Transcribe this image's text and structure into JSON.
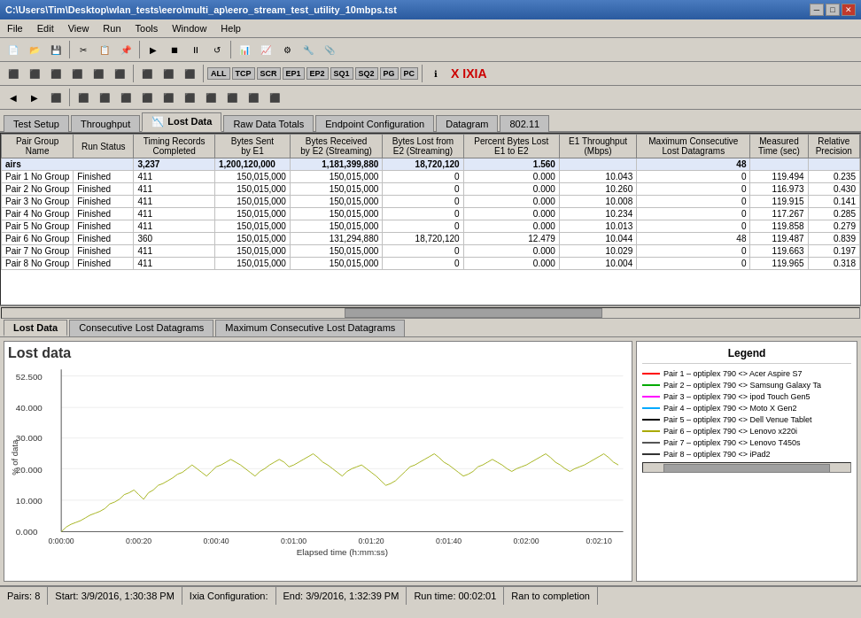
{
  "titleBar": {
    "text": "C:\\Users\\Tim\\Desktop\\wlan_tests\\eero\\multi_ap\\eero_stream_test_utility_10mbps.tst",
    "minimize": "─",
    "maximize": "□",
    "close": "✕"
  },
  "menuBar": {
    "items": [
      "File",
      "Edit",
      "View",
      "Run",
      "Tools",
      "Window",
      "Help"
    ]
  },
  "toolbar1": {
    "labels": [
      "TCP",
      "SCR",
      "EP1",
      "EP2",
      "SQ1",
      "SQ2",
      "PG",
      "PC"
    ]
  },
  "tabs": {
    "items": [
      "Test Setup",
      "Throughput",
      "Lost Data",
      "Raw Data Totals",
      "Endpoint Configuration",
      "Datagram",
      "802.11"
    ]
  },
  "tableHeaders": {
    "row1": [
      "Pair Group",
      "Run Status",
      "Timing Records",
      "Bytes Sent",
      "Bytes Received",
      "Bytes Lost from",
      "Percent Bytes Lost",
      "E1 Throughput",
      "Maximum Consecutive",
      "Measured",
      "Relative"
    ],
    "row2": [
      "Name",
      "",
      "Completed",
      "by E1",
      "by E2 (Streaming)",
      "E2 (Streaming)",
      "E1 to E2",
      "(Mbps)",
      "Lost Datagrams",
      "Time (sec)",
      "Precision"
    ]
  },
  "tableData": {
    "summaryRow": {
      "name": "airs",
      "records": "3,237",
      "bytesSent": "1,200,120,000",
      "bytesReceived": "1,181,399,880",
      "bytesLost": "18,720,120",
      "percentLost": "1.560",
      "throughput": "",
      "maxConsec": "48",
      "measuredTime": "",
      "precision": ""
    },
    "rows": [
      {
        "name": "Pair 1",
        "group": "No Group",
        "status": "Finished",
        "records": "411",
        "bytesSent": "150,015,000",
        "bytesReceived": "150,015,000",
        "bytesLost": "0",
        "percentLost": "0.000",
        "throughput": "10.043",
        "maxConsec": "0",
        "measuredTime": "119.494",
        "precision": "0.235"
      },
      {
        "name": "Pair 2",
        "group": "No Group",
        "status": "Finished",
        "records": "411",
        "bytesSent": "150,015,000",
        "bytesReceived": "150,015,000",
        "bytesLost": "0",
        "percentLost": "0.000",
        "throughput": "10.260",
        "maxConsec": "0",
        "measuredTime": "116.973",
        "precision": "0.430"
      },
      {
        "name": "Pair 3",
        "group": "No Group",
        "status": "Finished",
        "records": "411",
        "bytesSent": "150,015,000",
        "bytesReceived": "150,015,000",
        "bytesLost": "0",
        "percentLost": "0.000",
        "throughput": "10.008",
        "maxConsec": "0",
        "measuredTime": "119.915",
        "precision": "0.141"
      },
      {
        "name": "Pair 4",
        "group": "No Group",
        "status": "Finished",
        "records": "411",
        "bytesSent": "150,015,000",
        "bytesReceived": "150,015,000",
        "bytesLost": "0",
        "percentLost": "0.000",
        "throughput": "10.234",
        "maxConsec": "0",
        "measuredTime": "117.267",
        "precision": "0.285"
      },
      {
        "name": "Pair 5",
        "group": "No Group",
        "status": "Finished",
        "records": "411",
        "bytesSent": "150,015,000",
        "bytesReceived": "150,015,000",
        "bytesLost": "0",
        "percentLost": "0.000",
        "throughput": "10.013",
        "maxConsec": "0",
        "measuredTime": "119.858",
        "precision": "0.279"
      },
      {
        "name": "Pair 6",
        "group": "No Group",
        "status": "Finished",
        "records": "360",
        "bytesSent": "150,015,000",
        "bytesReceived": "131,294,880",
        "bytesLost": "18,720,120",
        "percentLost": "12.479",
        "throughput": "10.044",
        "maxConsec": "48",
        "measuredTime": "119.487",
        "precision": "0.839"
      },
      {
        "name": "Pair 7",
        "group": "No Group",
        "status": "Finished",
        "records": "411",
        "bytesSent": "150,015,000",
        "bytesReceived": "150,015,000",
        "bytesLost": "0",
        "percentLost": "0.000",
        "throughput": "10.029",
        "maxConsec": "0",
        "measuredTime": "119.663",
        "precision": "0.197"
      },
      {
        "name": "Pair 8",
        "group": "No Group",
        "status": "Finished",
        "records": "411",
        "bytesSent": "150,015,000",
        "bytesReceived": "150,015,000",
        "bytesLost": "0",
        "percentLost": "0.000",
        "throughput": "10.004",
        "maxConsec": "0",
        "measuredTime": "119.965",
        "precision": "0.318"
      }
    ]
  },
  "chartTabs": {
    "items": [
      "Lost Data",
      "Consecutive Lost Datagrams",
      "Maximum Consecutive Lost Datagrams"
    ]
  },
  "chart": {
    "title": "Lost data",
    "xLabel": "Elapsed time (h:mm:ss)",
    "yLabel": "% of data",
    "yMax": "52.500",
    "yTicks": [
      "52.500",
      "40.000",
      "30.000",
      "20.000",
      "10.000",
      "0.000"
    ],
    "xTicks": [
      "0:00:00",
      "0:00:20",
      "0:00:40",
      "0:01:00",
      "0:01:20",
      "0:01:40",
      "0:02:00",
      "0:02:10"
    ]
  },
  "legend": {
    "title": "Legend",
    "items": [
      {
        "color": "#ff0000",
        "label": "Pair 1 – optiplex 790 <> Acer Aspire S7"
      },
      {
        "color": "#00aa00",
        "label": "Pair 2 – optiplex 790 <> Samsung Galaxy Ta"
      },
      {
        "color": "#ff00ff",
        "label": "Pair 3 – optiplex 790 <> ipod Touch Gen5"
      },
      {
        "color": "#00aaff",
        "label": "Pair 4 – optiplex 790 <> Moto X Gen2"
      },
      {
        "color": "#000000",
        "label": "Pair 5 – optiplex 790 <> Dell Venue Tablet"
      },
      {
        "color": "#aaaa00",
        "label": "Pair 6 – optiplex 790 <> Lenovo x220i"
      },
      {
        "color": "#555555",
        "label": "Pair 7 – optiplex 790 <> Lenovo T450s"
      },
      {
        "color": "#333333",
        "label": "Pair 8 – optiplex 790 <> iPad2"
      }
    ]
  },
  "statusBar": {
    "pairs": "Pairs: 8",
    "start": "Start: 3/9/2016, 1:30:38 PM",
    "ixia": "Ixia Configuration:",
    "end": "End: 3/9/2016, 1:32:39 PM",
    "runtime": "Run time: 00:02:01",
    "completion": "Ran to completion"
  }
}
